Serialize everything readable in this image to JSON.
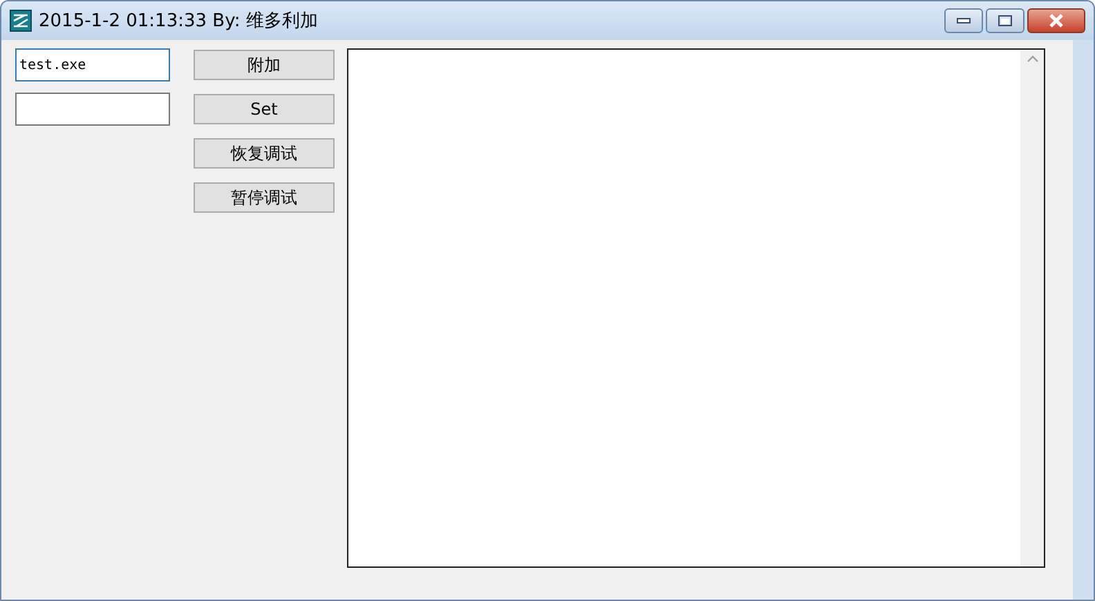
{
  "window": {
    "title": "2015-1-2 01:13:33 By: 维多利加"
  },
  "fields": [
    {
      "value": "test.exe",
      "focused": true
    },
    {
      "focused": false
    }
  ],
  "buttons": [
    "附加",
    "Set",
    "恢复调试",
    "暂停调试"
  ]
}
